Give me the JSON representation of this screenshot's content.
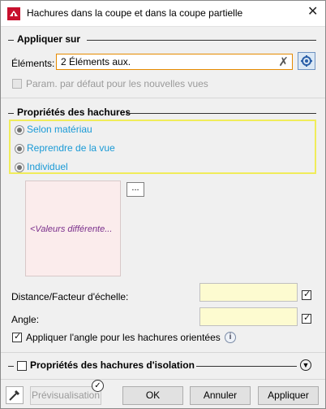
{
  "window": {
    "title": "Hachures dans la coupe et dans la coupe partielle",
    "close_icon": "close-icon"
  },
  "section_apply": {
    "title": "Appliquer sur",
    "elements_label": "Éléments:",
    "elements_value": "2 Éléments aux.",
    "default_param_label": "Param. par défaut pour les nouvelles vues",
    "default_param_checked": false,
    "default_param_enabled": false
  },
  "section_props": {
    "title": "Propriétés des hachures",
    "radios": [
      {
        "label": "Selon matériau"
      },
      {
        "label": "Reprendre de la vue"
      },
      {
        "label": "Individuel"
      }
    ],
    "preview_text": "<Valeurs différente...",
    "more_button": "...",
    "distance_label": "Distance/Facteur d'échelle:",
    "distance_checked": true,
    "angle_label": "Angle:",
    "angle_checked": true,
    "oriented_label": "Appliquer l'angle pour les hachures orientées",
    "oriented_checked": true
  },
  "section_isolation": {
    "title": "Propriétés des hachures d'isolation",
    "checked": false
  },
  "buttons": {
    "preview": "Prévisualisation",
    "ok": "OK",
    "cancel": "Annuler",
    "apply": "Appliquer"
  },
  "colors": {
    "highlight_orange": "#e58a00",
    "radio_text": "#1a9ad6",
    "group_yellow": "#f0ec5a",
    "input_yellow": "#fdfbd0"
  }
}
